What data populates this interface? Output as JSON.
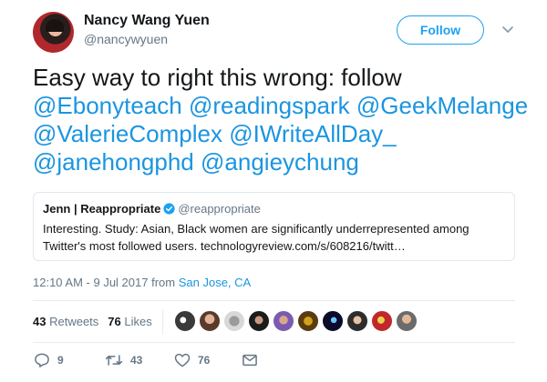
{
  "author": {
    "display_name": "Nancy Wang Yuen",
    "handle": "@nancywyuen",
    "avatar_icon": "profile-photo"
  },
  "follow_button": {
    "label": "Follow",
    "color": "#1da1f2"
  },
  "caret_icon": "chevron-down-icon",
  "tweet": {
    "lead_text": "Easy way to right this wrong: follow",
    "mentions": [
      "@Ebonyteach",
      "@readingspark",
      "@GeekMelange",
      "@ValerieComplex",
      "@IWriteAllDay_",
      "@janehongphd",
      "@angieychung"
    ],
    "mention_color": "#1b95e0"
  },
  "quoted_tweet": {
    "name": "Jenn | Reappropriate",
    "verified_icon": "verified-badge-icon",
    "handle": "@reappropriate",
    "text_line_1": "Interesting. Study: Asian, Black women are significantly underrepresented among",
    "text_line_2": "Twitter's most followed users. technologyreview.com/s/608216/twitt…"
  },
  "meta": {
    "time_date": "12:10 AM - 9 Jul 2017 from",
    "location": "San Jose, CA"
  },
  "stats": {
    "retweets_count": "43",
    "retweets_label": "Retweets",
    "likes_count": "76",
    "likes_label": "Likes",
    "liker_avatar_count": 10
  },
  "actions": {
    "reply_icon": "reply-icon",
    "reply_count": "9",
    "retweet_icon": "retweet-icon",
    "retweet_count": "43",
    "like_icon": "heart-icon",
    "like_count": "76",
    "dm_icon": "envelope-icon"
  }
}
